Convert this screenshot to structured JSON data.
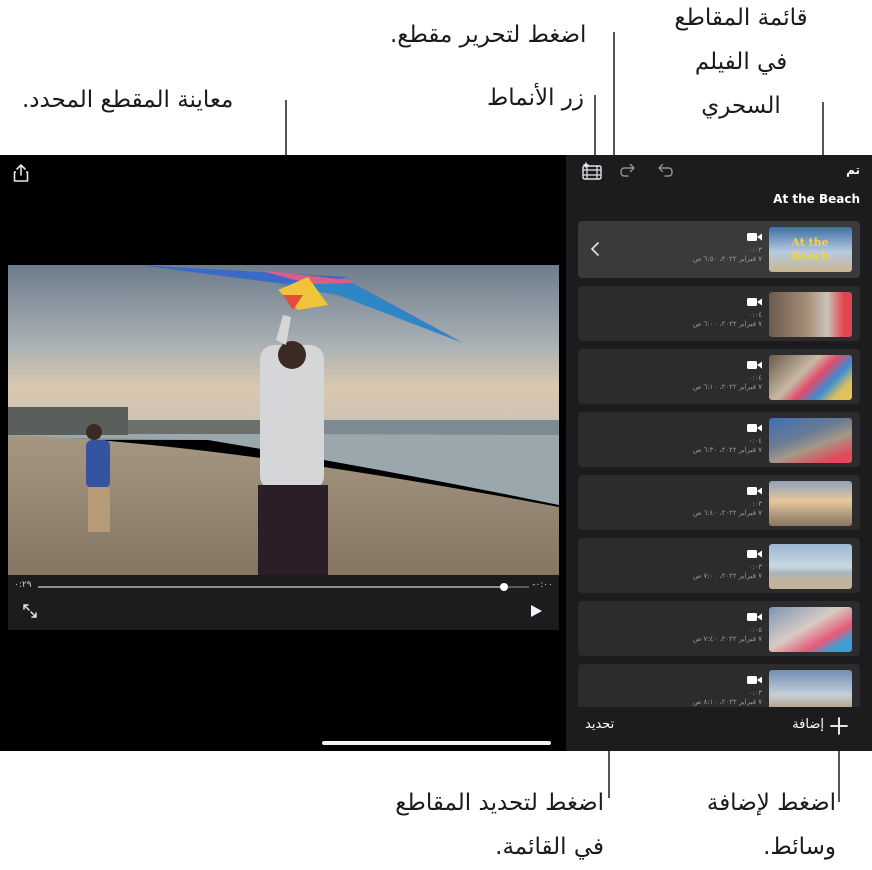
{
  "callouts": {
    "clip_list": [
      "قائمة المقاطع",
      "في الفيلم",
      "السحري"
    ],
    "edit_clip": "اضغط لتحرير مقطع.",
    "styles_button": "زر الأنماط",
    "preview": "معاينة المقطع المحدد.",
    "select_clips": [
      "اضغط لتحديد المقاطع",
      "في القائمة."
    ],
    "add_media": [
      "اضغط لإضافة",
      "وسائط."
    ]
  },
  "toolbar": {
    "done": "تم"
  },
  "movie": {
    "title": "At the Beach"
  },
  "player": {
    "elapsed": "٠:٢٩",
    "remaining": "-٠:٠٠",
    "progress": 0.95
  },
  "clips": [
    {
      "duration": "٠:٠٣",
      "date": "٧ فبراير ٢٠٢٢، ٦:٥٠ ص",
      "thumb_text": "At the Beach",
      "selected": true
    },
    {
      "duration": "٠:٠٤",
      "date": "٧ فبراير ٢٠٢٢، ٦:٠٠ ص"
    },
    {
      "duration": "٠:٠٤",
      "date": "٧ فبراير ٢٠٢٢، ٦:١٠ ص"
    },
    {
      "duration": "٠:٠٤",
      "date": "٧ فبراير ٢٠٢٢، ٦:٣٠ ص"
    },
    {
      "duration": "٠:٠٣",
      "date": "٧ فبراير ٢٠٢٢، ٦:٤٠ ص"
    },
    {
      "duration": "٠:٠٣",
      "date": "٧ فبراير ٢٠٢٢، ٧:٠٠ ص"
    },
    {
      "duration": "٠:٠٥",
      "date": "٧ فبراير ٢٠٢٢، ٧:٤٠ ص"
    },
    {
      "duration": "٠:٠٣",
      "date": "٧ فبراير ٢٠٢٢، ٨:١٠ ص"
    }
  ],
  "bottom_bar": {
    "add": "إضافة",
    "select": "تحديد"
  },
  "colors": {
    "panel": "#1c1c1e",
    "clip": "#2c2c2e",
    "selected_clip": "#3a3a3c"
  }
}
